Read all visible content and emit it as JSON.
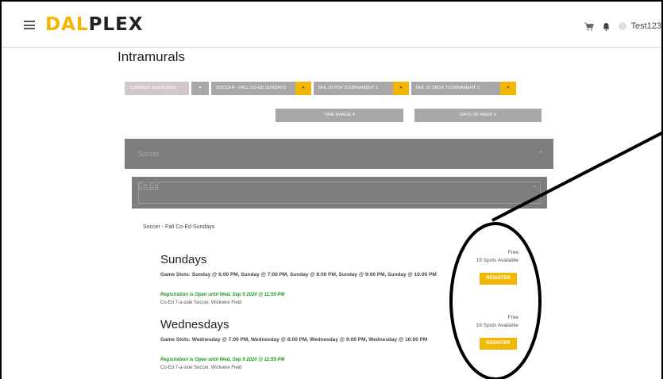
{
  "header": {
    "logo_part1": "DAL",
    "logo_part2": "PLEX",
    "menu_icon": "hamburger-icon",
    "cart_icon": "cart-icon",
    "bell_icon": "bell-icon",
    "username": "Test123"
  },
  "page": {
    "title": "Intramurals"
  },
  "filters": {
    "season_label": "CURRENT SEASON(S):",
    "dropdown_caret": "▾",
    "chips": [
      {
        "label": "SOCCER - FALL CO-ED SUNDAYS",
        "remove": "×"
      },
      {
        "label": "NHL 20 PS4 TOURNAMENT 1",
        "remove": "×"
      },
      {
        "label": "NHL 20 XBOX TOURNAMENT 1",
        "remove": "×"
      }
    ],
    "time_range_label": "TIME RANGE ▾",
    "days_of_week_label": "DAYS OF WEEK ▾"
  },
  "accordion": {
    "sport_label": "Soccer",
    "division_label": "Co-Ed",
    "caret": "^"
  },
  "league": {
    "name": "Soccer - Fall Co-Ed Sundays",
    "sessions": [
      {
        "day": "Sundays",
        "game_slots": "Game Slots: Sunday @ 6:00 PM, Sunday @ 7:00 PM, Sunday @ 8:00 PM, Sunday @ 9:00 PM, Sunday @ 10:00 PM",
        "registration": "Registration is Open until Wed, Sep 9 2020 @ 11:59 PM",
        "venue": "Co-Ed 7-a-side Soccer, Wickwire Field",
        "price": "Free",
        "spots": "19 Spots Available",
        "register_label": "REGISTER"
      },
      {
        "day": "Wednesdays",
        "game_slots": "Game Slots: Wednesday @ 7:00 PM, Wednesday @ 8:00 PM, Wednesday @ 9:00 PM, Wednesday @ 10:00 PM",
        "registration": "Registration is Open until Wed, Sep 9 2020 @ 11:59 PM",
        "venue": "Co-Ed 7-a-side Soccer, Wickwire Field",
        "price": "Free",
        "spots": "16 Spots Available",
        "register_label": "REGISTER"
      }
    ]
  },
  "colors": {
    "accent": "#f2b705",
    "chip_gray": "#a8a8a8",
    "accordion_gray": "#7d7d7d",
    "registration_green": "#1f9a1f"
  }
}
